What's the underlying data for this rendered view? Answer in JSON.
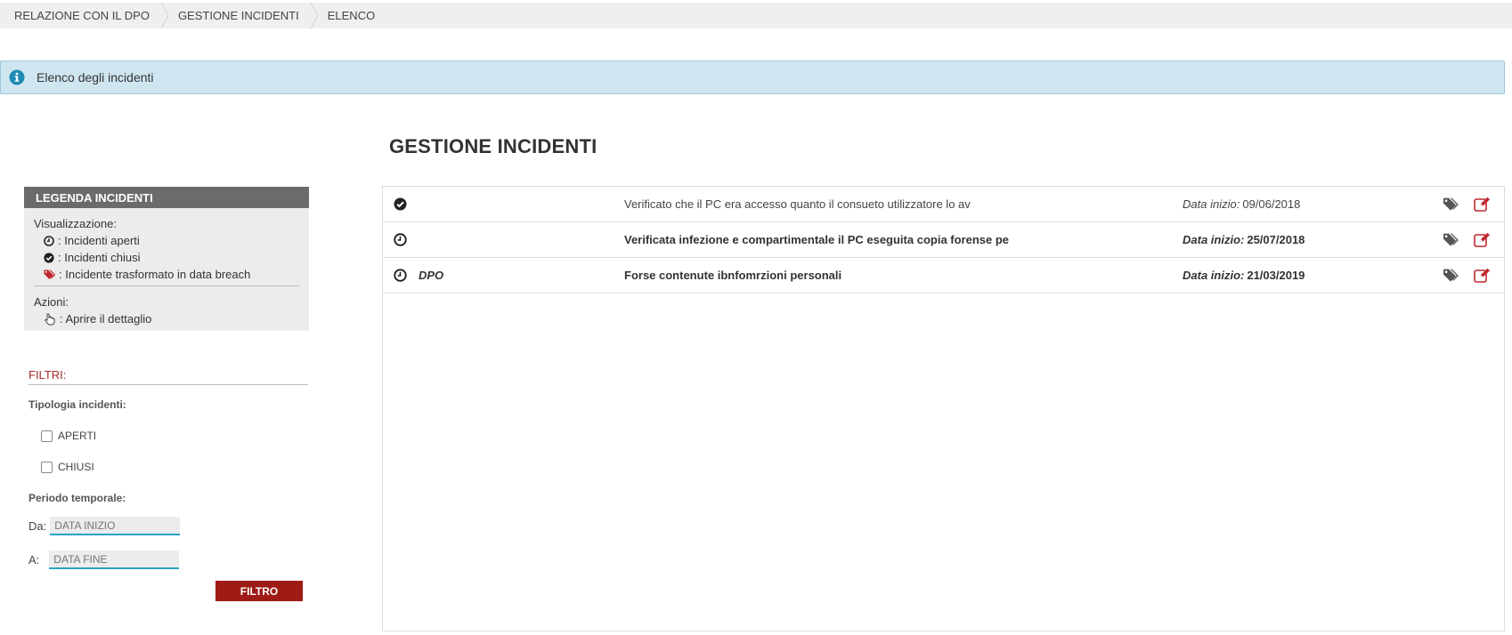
{
  "breadcrumb": [
    "RELAZIONE CON IL DPO",
    "GESTIONE INCIDENTI",
    "ELENCO"
  ],
  "info": {
    "text": "Elenco degli incidenti",
    "icon": "info-icon",
    "color": "#2a8cb3"
  },
  "page_title": "GESTIONE INCIDENTI",
  "legend": {
    "header": "LEGENDA INCIDENTI",
    "visualizzazione_label": "Visualizzazione:",
    "items": [
      {
        "icon": "clock-icon",
        "label": ": Incidenti aperti"
      },
      {
        "icon": "check-circle-icon",
        "label": ": Incidenti chiusi"
      },
      {
        "icon": "tag-icon",
        "label": ": Incidente trasformato in data breach"
      }
    ],
    "azioni_label": "Azioni:",
    "action": {
      "icon": "hand-pointer-icon",
      "label": ": Aprire il dettaglio"
    }
  },
  "filters": {
    "title": "FILTRI:",
    "tipologia_label": "Tipologia incidenti:",
    "checkboxes": [
      {
        "label": "APERTI",
        "checked": false
      },
      {
        "label": "CHIUSI",
        "checked": false
      }
    ],
    "periodo_label": "Periodo temporale:",
    "da_label": "Da:",
    "a_label": "A:",
    "data_inizio_placeholder": "DATA INIZIO",
    "data_fine_placeholder": "DATA FINE",
    "button": "FILTRO"
  },
  "incidents": [
    {
      "status": "closed",
      "status_icon": "check-circle-icon",
      "owner": "",
      "description": "Verificato che il PC era accesso quanto il consueto utilizzatore lo av",
      "date_label": "Data inizio:",
      "date": "09/06/2018",
      "bold": false
    },
    {
      "status": "open",
      "status_icon": "clock-icon",
      "owner": "",
      "description": "Verificata infezione e compartimentale il PC eseguita copia forense pe",
      "date_label": "Data inizio:",
      "date": "25/07/2018",
      "bold": true
    },
    {
      "status": "open",
      "status_icon": "clock-icon",
      "owner": "DPO",
      "description": "Forse contenute ibnfomrzioni personali",
      "date_label": "Data inizio:",
      "date": "21/03/2019",
      "bold": true
    }
  ],
  "colors": {
    "accent": "#9e1b16",
    "legend_header": "#6b6b6b",
    "info_bg": "#cfe6f1",
    "edit_icon": "#c0282d"
  }
}
